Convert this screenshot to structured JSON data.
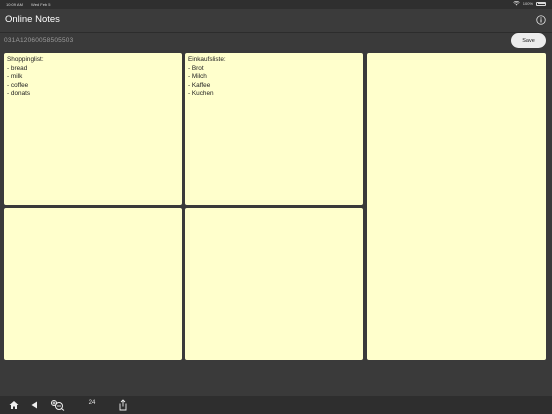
{
  "status_bar": {
    "time": "10:09 AM",
    "date": "Wed Feb 5",
    "battery": "100%"
  },
  "nav": {
    "title": "Online Notes",
    "info_icon": "info-icon"
  },
  "subbar": {
    "note_id": "031A12060058505503",
    "save_label": "Save"
  },
  "notes": [
    {
      "text": "Shoppinglist:\n- bread\n- milk\n- coffee\n- donats"
    },
    {
      "text": "Einkaufsliste:\n- Brot\n- Milch\n- Kaffee\n- Kuchen"
    },
    {
      "text": ""
    },
    {
      "text": ""
    },
    {
      "text": ""
    }
  ],
  "toolbar": {
    "home_icon": "home-icon",
    "back_icon": "back-icon",
    "zoom_icon": "zoom-icon",
    "count": "24",
    "share_icon": "share-icon"
  },
  "colors": {
    "background": "#3a3a3a",
    "note": "#ffffcc",
    "save_button": "#ececec"
  }
}
